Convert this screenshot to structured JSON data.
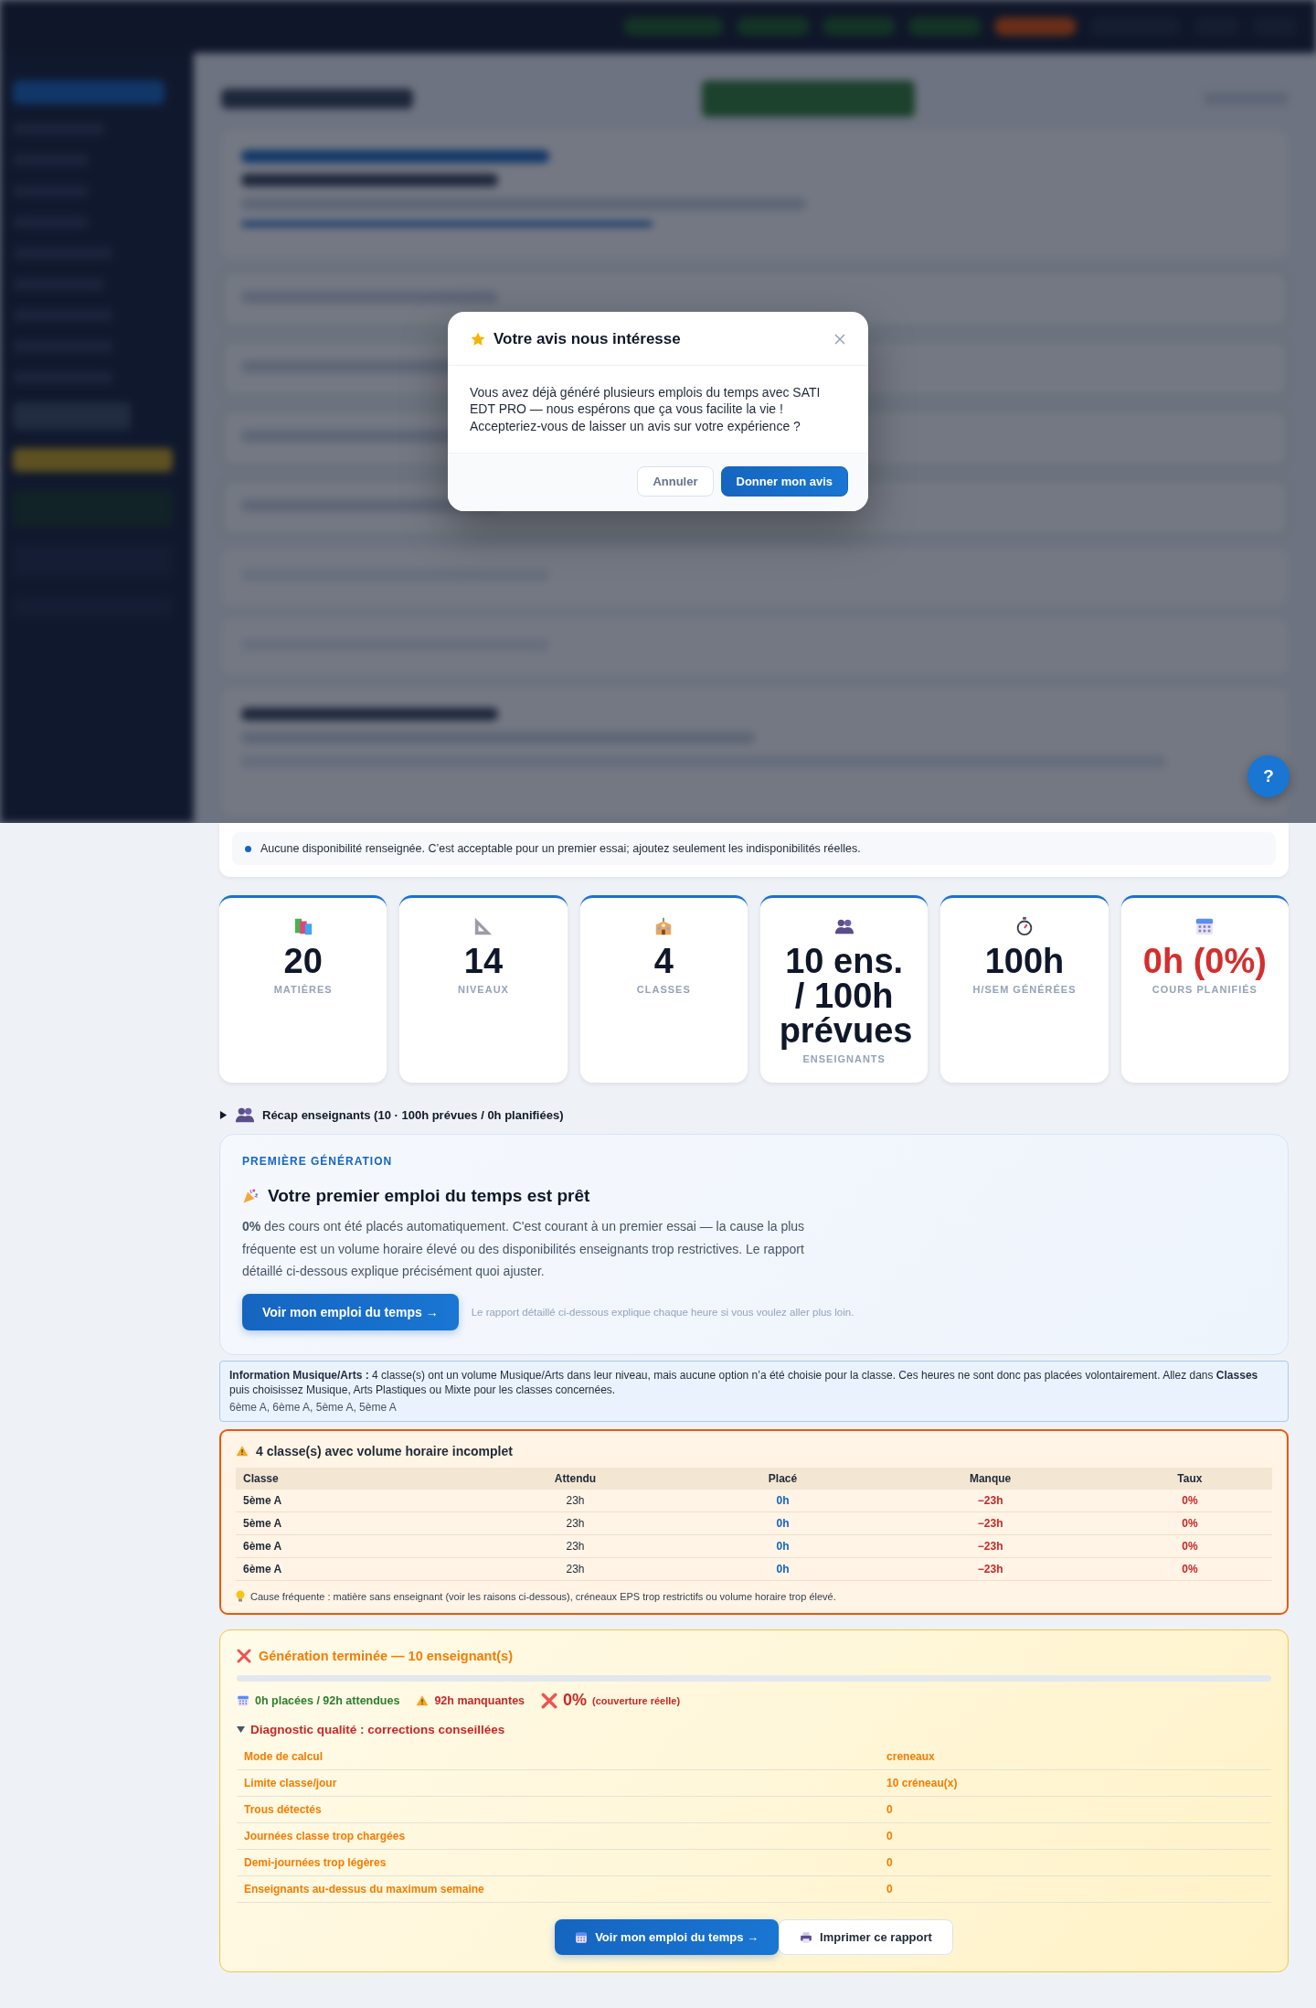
{
  "dialog": {
    "title": "Votre avis nous intéresse",
    "message": "Vous avez déjà généré plusieurs emplois du temps avec SATI EDT PRO — nous espérons que ça vous facilite la vie ! Accepteriez-vous de laisser un avis sur votre expérience ?",
    "buttons": [
      {
        "label": "Annuler",
        "kind": "secondary"
      },
      {
        "label": "Donner mon avis",
        "kind": "primary"
      }
    ]
  },
  "help_button": {
    "label": "?"
  },
  "diagnostic_notes": [
    "Aucune disponibilité renseignée. C’est acceptable pour un premier essai; ajoutez seulement les indisponibilités réelles."
  ],
  "stats": [
    {
      "value": "20",
      "label": "MATIÈRES",
      "alert": false
    },
    {
      "value": "14",
      "label": "NIVEAUX",
      "alert": false
    },
    {
      "value": "4",
      "label": "CLASSES",
      "alert": false
    },
    {
      "value": "10 ens. / 100h prévues",
      "label": "ENSEIGNANTS",
      "alert": false
    },
    {
      "value": "100h",
      "label": "H/SEM GÉNÉRÉES",
      "alert": false
    },
    {
      "value": "0h (0%)",
      "label": "COURS PLANIFIÉS",
      "alert": true
    }
  ],
  "recap": {
    "label": "Récap enseignants (10 · 100h prévues / 0h planifiées)",
    "expanded": false
  },
  "first_generation": {
    "eyebrow": "PREMIÈRE GÉNÉRATION",
    "title": "Votre premier emploi du temps est prêt",
    "text": "**0%** des cours ont été placés automatiquement. C'est courant à un premier essai — la cause la plus fréquente est un volume horaire élevé ou des disponibilités enseignants trop restrictives. Le rapport détaillé ci-dessous explique précisément quoi ajuster.",
    "button": "Voir mon emploi du temps →",
    "hint": "Le rapport détaillé ci-dessous explique chaque heure si vous voulez aller plus loin."
  },
  "music_info": {
    "text": "**Information Musique/Arts :** 4 classe(s) ont un volume Musique/Arts dans leur niveau, mais aucune option n’a été choisie pour la classe. Ces heures ne sont donc pas placées volontairement. Allez dans **Classes** puis choisissez Musique, Arts Plastiques ou Mixte pour les classes concernées.",
    "classes": "6ème A, 6ème A, 5ème A, 5ème A"
  },
  "incomplete": {
    "title": "4 classe(s) avec volume horaire incomplet",
    "columns": [
      "Classe",
      "Attendu",
      "Placé",
      "Manque",
      "Taux"
    ],
    "rows": [
      [
        "5ème A",
        "23h",
        "0h",
        "−23h",
        "0%"
      ],
      [
        "5ème A",
        "23h",
        "0h",
        "−23h",
        "0%"
      ],
      [
        "6ème A",
        "23h",
        "0h",
        "−23h",
        "0%"
      ],
      [
        "6ème A",
        "23h",
        "0h",
        "−23h",
        "0%"
      ]
    ],
    "note": "Cause fréquente : matière sans enseignant (voir les raisons ci-dessous), créneaux EPS trop restrictifs ou volume horaire trop élevé."
  },
  "generation": {
    "title": "Génération terminée — 10 enseignant(s)",
    "level": 0,
    "placed": "0h placées / 92h attendues",
    "missing": "92h manquantes",
    "coverage": "0%",
    "coverage_note": "(couverture réelle)",
    "diagnostic": {
      "title": "Diagnostic qualité : corrections conseillées",
      "expanded": true,
      "rows": [
        {
          "label": "Mode de calcul",
          "value": "creneaux"
        },
        {
          "label": "Limite classe/jour",
          "value": "10 créneau(x)"
        },
        {
          "label": "Trous détectés",
          "value": "0"
        },
        {
          "label": "Journées classe trop chargées",
          "value": "0"
        },
        {
          "label": "Demi-journées trop légères",
          "value": "0"
        },
        {
          "label": "Enseignants au-dessus du maximum semaine",
          "value": "0"
        }
      ]
    },
    "buttons": [
      {
        "label": "Voir mon emploi du temps →",
        "kind": "primary"
      },
      {
        "label": "Imprimer ce rapport",
        "kind": "secondary"
      }
    ]
  }
}
